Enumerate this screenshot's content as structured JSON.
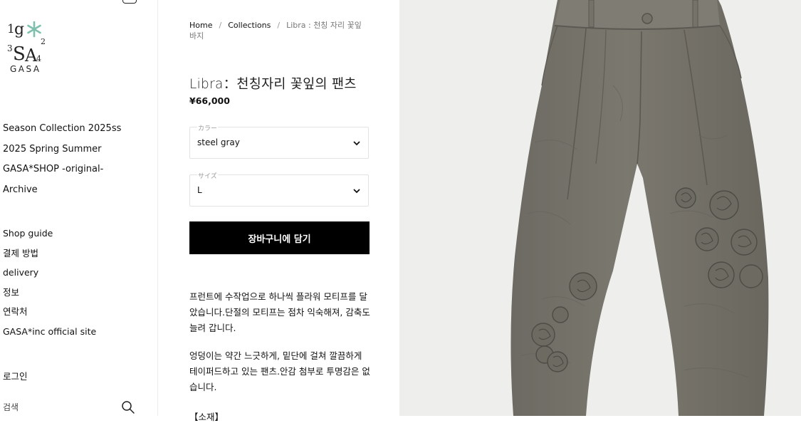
{
  "brand": {
    "logo_text": "GASA",
    "logo_marks": {
      "1": "1",
      "g": "g",
      "3": "3",
      "S": "S",
      "A": "A",
      "2": "2",
      "4": "4"
    }
  },
  "nav_collections": [
    {
      "label": "Season Collection 2025ss"
    },
    {
      "label": "2025 Spring Summer"
    },
    {
      "label": "GASA*SHOP -original-"
    },
    {
      "label": "Archive"
    }
  ],
  "nav_info": [
    {
      "label": "Shop guide"
    },
    {
      "label": "결제 방법"
    },
    {
      "label": "delivery"
    },
    {
      "label": "정보"
    },
    {
      "label": "연락처"
    },
    {
      "label": "GASA*inc official site"
    }
  ],
  "account": {
    "login_label": "로그인"
  },
  "search": {
    "placeholder": "검색"
  },
  "breadcrumb": {
    "home": "Home",
    "collections": "Collections",
    "current": "Libra : 천칭 자리 꽃잎 바지",
    "separator": "/"
  },
  "product": {
    "title": "Libra：천칭자리 꽃잎의 팬츠",
    "price": "¥66,000",
    "color_label": "カラー",
    "color_value": "steel gray",
    "size_label": "サイズ",
    "size_value": "L",
    "add_to_cart": "장바구니에 담기",
    "description_1": "프런트에 수작업으로 하나씩 플라워 모티프를 달았습니다.단절의 모티프는 점차 익숙해져, 감축도 늘려 갑니다.",
    "description_2": "엉덩이는 약간 느긋하게, 밑단에 걸쳐 깔끔하게 테이퍼드하고 있는 팬츠.안감 첨부로 투명감은 없습니다.",
    "section_heading": "【소재】"
  },
  "colors": {
    "accent_star": "#7fbfae",
    "button_bg": "#000000",
    "pants": "#77746b"
  }
}
